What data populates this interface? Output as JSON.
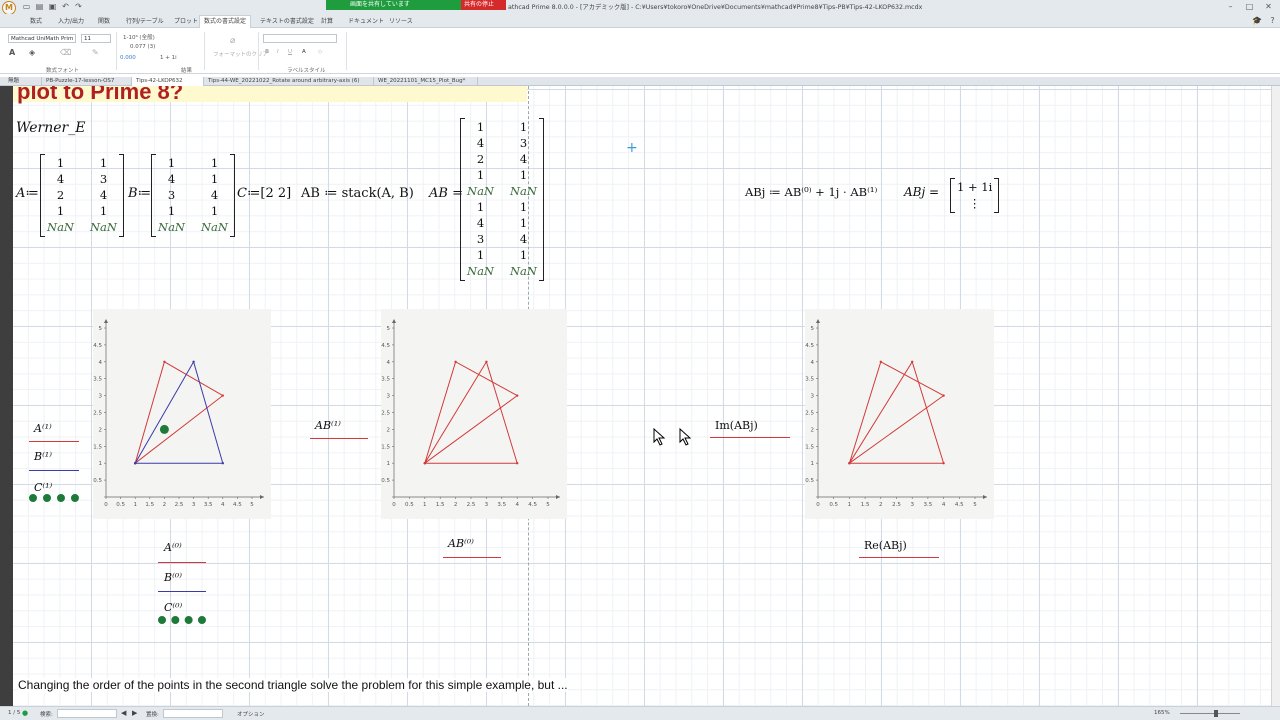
{
  "window": {
    "title": "athcad Prime 8.0.0.0 - [アカデミック版] - C:¥Users¥tokoro¥OneDrive¥Documents¥mathcad¥Prime8¥Tips-PB¥Tips-42-LKOP632.mcdx",
    "app_icon_letter": "M",
    "share_label": "画面を共有しています",
    "share_stop_label": "共有の停止"
  },
  "ribbon": {
    "tabs": [
      "数式",
      "入力/出力",
      "関数",
      "行列/テーブル",
      "プロット",
      "数式の書式設定",
      "テキストの書式設定",
      "計算",
      "ドキュメント",
      "リソース"
    ],
    "active_tab": "数式の書式設定",
    "font_name": "Mathcad UniMath Prim",
    "font_size": "11",
    "number_format": "1-10⁶ (全般)",
    "num_display_1": "0.077 (3)",
    "num_display_2": "0.000",
    "num_display_3": "1 + 1i",
    "clear_format_label": "フォーマットのクリア",
    "group_labels": [
      "数式フォント",
      "結果",
      "ラベルスタイル"
    ]
  },
  "doc_tabs": [
    {
      "label": "無題",
      "active": false
    },
    {
      "label": "PB-Puzzle-17-lesson-OS7",
      "active": false
    },
    {
      "label": "Tips-42-LKOP632",
      "active": true
    },
    {
      "label": "Tips-44-WE_20221022_Rotate around arbitrary-axis (6)",
      "active": false
    },
    {
      "label": "WE_20221101_MC15_Plot_Bug*",
      "active": false
    }
  ],
  "worksheet": {
    "heading": "plot to Prime 8?",
    "author": "Werner_E",
    "A_label": "A",
    "B_label": "B",
    "C_label": "C",
    "C_value": "[2  2]",
    "AB_def": "AB ≔ stack(A, B)",
    "AB_label": "AB",
    "ABj_def": "ABj ≔ AB⁽⁰⁾ + 1j · AB⁽¹⁾",
    "ABj_label": "ABj",
    "ABj_value_first": "1 + 1i",
    "ABj_value_more": "⋮",
    "matrix_A": [
      [
        "1",
        "1"
      ],
      [
        "4",
        "3"
      ],
      [
        "2",
        "4"
      ],
      [
        "1",
        "1"
      ],
      [
        "NaN",
        "NaN"
      ]
    ],
    "matrix_B": [
      [
        "1",
        "1"
      ],
      [
        "4",
        "1"
      ],
      [
        "3",
        "4"
      ],
      [
        "1",
        "1"
      ],
      [
        "NaN",
        "NaN"
      ]
    ],
    "matrix_AB": [
      [
        "1",
        "1"
      ],
      [
        "4",
        "3"
      ],
      [
        "2",
        "4"
      ],
      [
        "1",
        "1"
      ],
      [
        "NaN",
        "NaN"
      ],
      [
        "1",
        "1"
      ],
      [
        "4",
        "1"
      ],
      [
        "3",
        "4"
      ],
      [
        "1",
        "1"
      ],
      [
        "NaN",
        "NaN"
      ]
    ],
    "plot1": {
      "y_legends": [
        "A⁽¹⁾",
        "B⁽¹⁾",
        "C⁽¹⁾"
      ],
      "x_legends": [
        "A⁽⁰⁾",
        "B⁽⁰⁾",
        "C⁽⁰⁾"
      ]
    },
    "plot2": {
      "y_legend": "AB⁽¹⁾",
      "x_legend": "AB⁽⁰⁾"
    },
    "plot3": {
      "y_legend": "Im(ABj)",
      "x_legend": "Re(ABj)"
    },
    "caption": "Changing the order of the points in the second triangle solve the problem for this simple example, but ..."
  },
  "chart_data": [
    {
      "type": "scatter",
      "xlim": [
        0,
        5
      ],
      "ylim": [
        0,
        5
      ],
      "x_ticks": [
        "0",
        "0.5",
        "1",
        "1.5",
        "2",
        "2.5",
        "3",
        "3.5",
        "4",
        "4.5",
        "5"
      ],
      "y_ticks": [
        "0",
        "0.5",
        "1",
        "1.5",
        "2",
        "2.5",
        "3",
        "3.5",
        "4",
        "4.5",
        "5"
      ],
      "series": [
        {
          "name": "A",
          "color": "#d23a3a",
          "style": "line",
          "points": [
            [
              1,
              1
            ],
            [
              4,
              3
            ],
            [
              2,
              4
            ],
            [
              1,
              1
            ]
          ]
        },
        {
          "name": "B",
          "color": "#3a3aaa",
          "style": "line",
          "points": [
            [
              1,
              1
            ],
            [
              4,
              1
            ],
            [
              3,
              4
            ],
            [
              1,
              1
            ]
          ]
        },
        {
          "name": "C",
          "color": "#1f7a3a",
          "style": "marker",
          "points": [
            [
              2,
              2
            ]
          ]
        }
      ]
    },
    {
      "type": "line",
      "xlim": [
        0,
        5
      ],
      "ylim": [
        0,
        5
      ],
      "x_ticks": [
        "0",
        "0.5",
        "1",
        "1.5",
        "2",
        "2.5",
        "3",
        "3.5",
        "4",
        "4.5",
        "5"
      ],
      "y_ticks": [
        "0",
        "0.5",
        "1",
        "1.5",
        "2",
        "2.5",
        "3",
        "3.5",
        "4",
        "4.5",
        "5"
      ],
      "series": [
        {
          "name": "AB",
          "color": "#d23a3a",
          "style": "line",
          "points": [
            [
              1,
              1
            ],
            [
              4,
              3
            ],
            [
              2,
              4
            ],
            [
              1,
              1
            ],
            [
              4,
              1
            ],
            [
              3,
              4
            ],
            [
              1,
              1
            ]
          ]
        }
      ]
    },
    {
      "type": "line",
      "xlim": [
        0,
        5
      ],
      "ylim": [
        0,
        5
      ],
      "x_ticks": [
        "0",
        "0.5",
        "1",
        "1.5",
        "2",
        "2.5",
        "3",
        "3.5",
        "4",
        "4.5",
        "5"
      ],
      "y_ticks": [
        "0",
        "0.5",
        "1",
        "1.5",
        "2",
        "2.5",
        "3",
        "3.5",
        "4",
        "4.5",
        "5"
      ],
      "series": [
        {
          "name": "ABj",
          "color": "#d23a3a",
          "style": "line",
          "points": [
            [
              1,
              1
            ],
            [
              4,
              3
            ],
            [
              2,
              4
            ],
            [
              1,
              1
            ],
            [
              4,
              1
            ],
            [
              3,
              4
            ],
            [
              1,
              1
            ]
          ]
        }
      ]
    }
  ],
  "status": {
    "page": "1 / 5",
    "search_label": "検索:",
    "replace_label": "置換:",
    "options_label": "オプション",
    "zoom": "165%"
  },
  "colors": {
    "accent": "#c8841e",
    "share_green": "#1f9d3e",
    "share_red": "#d42a2a",
    "trace_red": "#d23a3a",
    "trace_blue": "#3a3aaa",
    "trace_green": "#1f7a3a"
  }
}
